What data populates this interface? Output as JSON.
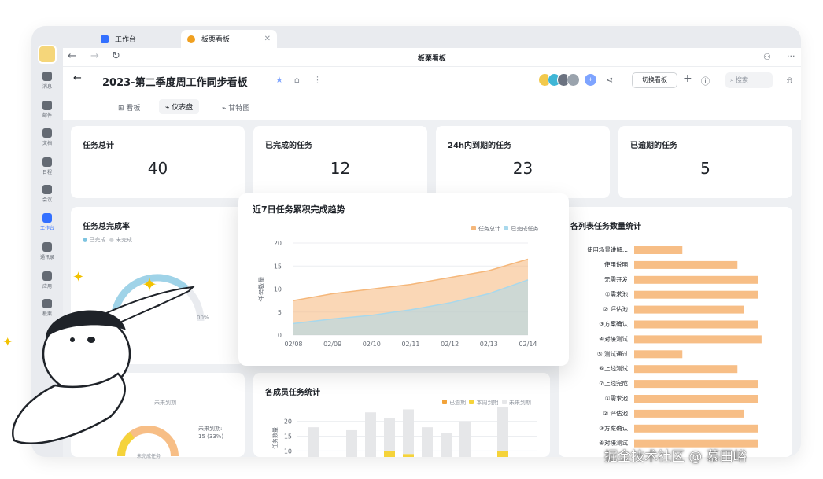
{
  "window": {
    "tabs": [
      {
        "label": "工作台",
        "color": "#3370ff"
      },
      {
        "label": "板栗看板",
        "color": "#f0a020"
      }
    ],
    "nav_title": "板栗看板"
  },
  "rail": {
    "items": [
      {
        "label": "消息"
      },
      {
        "label": "邮件"
      },
      {
        "label": "文档"
      },
      {
        "label": "日程"
      },
      {
        "label": "会议"
      },
      {
        "label": "工作台",
        "active": true
      },
      {
        "label": "通讯录"
      },
      {
        "label": "应用"
      },
      {
        "label": "板栗"
      }
    ]
  },
  "header": {
    "title": "2023-第二季度周工作同步看板",
    "switch_label": "切换看板",
    "search_placeholder": "搜索"
  },
  "subtabs": [
    {
      "label": "看板"
    },
    {
      "label": "仪表盘",
      "active": true
    },
    {
      "label": "甘特图"
    }
  ],
  "kpis": [
    {
      "label": "任务总计",
      "value": "40"
    },
    {
      "label": "已完成的任务",
      "value": "12"
    },
    {
      "label": "24h内到期的任务",
      "value": "23"
    },
    {
      "label": "已逾期的任务",
      "value": "5"
    }
  ],
  "completion": {
    "title": "任务总完成率",
    "legend": [
      "已完成",
      "未完成"
    ],
    "value": "73",
    "left_tick": "0",
    "right_tick": "00%"
  },
  "trend": {
    "title": "近7日任务累积完成趋势",
    "ylabel": "任务数量",
    "colors": {
      "total": "#f5b77a",
      "done": "#a8d8ec"
    }
  },
  "columns_stats": {
    "title": "各列表任务数量统计",
    "bar_color": "#f7be86",
    "rows": [
      {
        "label": "使用场景讲解...",
        "value": 7
      },
      {
        "label": "使用说明",
        "value": 15
      },
      {
        "label": "无需开发",
        "value": 18
      },
      {
        "label": "①需求池",
        "value": 18
      },
      {
        "label": "② 评估池",
        "value": 16
      },
      {
        "label": "③方案确认",
        "value": 18
      },
      {
        "label": "④对接测试",
        "value": 18.5
      },
      {
        "label": "⑤ 测试通过",
        "value": 7
      },
      {
        "label": "⑥上线测试",
        "value": 15
      },
      {
        "label": "⑦上线完成",
        "value": 18
      },
      {
        "label": "①需求池",
        "value": 18
      },
      {
        "label": "② 评估池",
        "value": 16
      },
      {
        "label": "③方案确认",
        "value": 18
      },
      {
        "label": "④对接测试",
        "value": 18
      }
    ]
  },
  "member_stats": {
    "title": "各成员任务统计",
    "legend": [
      "已逾期",
      "本周到期",
      "未来到期"
    ],
    "colors": {
      "overdue": "#f2a33a",
      "this_week": "#f5d33a",
      "future": "#e6e7e9"
    },
    "ylabel": "任务数量"
  },
  "upcoming": {
    "tag": "未来到期",
    "caption_label": "未来到期:",
    "caption_value": "15 (33%)",
    "donut_label": "未完成任务"
  },
  "watermark": "掘金技术社区 @ 慕田峪",
  "chart_data": [
    {
      "type": "area",
      "title": "近7日任务累积完成趋势",
      "ylabel": "任务数量",
      "x": [
        "02/08",
        "02/09",
        "02/10",
        "02/11",
        "02/12",
        "02/13",
        "02/14"
      ],
      "ylim": [
        0,
        20
      ],
      "yticks": [
        0,
        5,
        10,
        15,
        20
      ],
      "series": [
        {
          "name": "任务总计",
          "values": [
            7.5,
            9,
            10,
            11,
            12.5,
            14,
            16.5
          ]
        },
        {
          "name": "已完成任务",
          "values": [
            2.5,
            3.5,
            4.3,
            5.5,
            7,
            9,
            12
          ]
        }
      ],
      "legend": "top-right"
    },
    {
      "type": "bar",
      "title": "各列表任务数量统计",
      "orientation": "horizontal",
      "categories": [
        "使用场景讲解...",
        "使用说明",
        "无需开发",
        "①需求池",
        "② 评估池",
        "③方案确认",
        "④对接测试",
        "⑤ 测试通过",
        "⑥上线测试",
        "⑦上线完成",
        "①需求池",
        "② 评估池",
        "③方案确认",
        "④对接测试"
      ],
      "values": [
        7,
        15,
        18,
        18,
        16,
        18,
        18.5,
        7,
        15,
        18,
        18,
        16,
        18,
        18
      ]
    },
    {
      "type": "bar",
      "title": "各成员任务统计",
      "ylabel": "任务数量",
      "yticks": [
        10,
        15,
        20
      ],
      "ylim": [
        8,
        22
      ],
      "stacked": true,
      "series": [
        {
          "name": "已逾期",
          "values": [
            0,
            0,
            0,
            0,
            0,
            0,
            0,
            0,
            0,
            0,
            0
          ]
        },
        {
          "name": "本周到期",
          "values": [
            0,
            0,
            0,
            0,
            2,
            1,
            0,
            0,
            0,
            0,
            2
          ]
        },
        {
          "name": "未来到期",
          "values": [
            10,
            0,
            9,
            15,
            11,
            15,
            10,
            8,
            12,
            0,
            17
          ]
        }
      ]
    },
    {
      "type": "gauge",
      "title": "任务总完成率",
      "value": 73
    }
  ]
}
